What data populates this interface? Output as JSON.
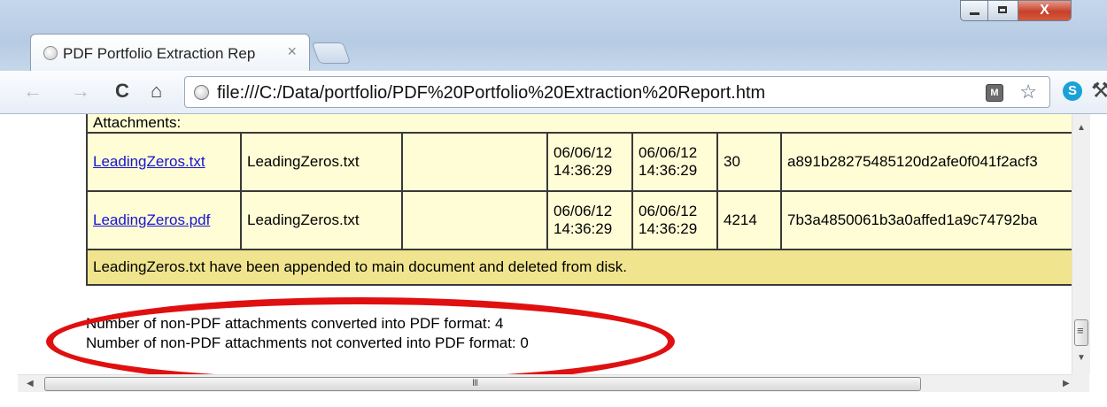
{
  "browser": {
    "tab_title": "PDF Portfolio Extraction Rep",
    "tab_close": "×",
    "address": "file:///C:/Data/portfolio/PDF%20Portfolio%20Extraction%20Report.htm",
    "nav": {
      "back": "←",
      "forward": "→",
      "reload": "C",
      "home": "⌂"
    },
    "window_controls": {
      "close": "X"
    },
    "star": "☆",
    "wrench": "🔧",
    "skype": "S",
    "shield": "M"
  },
  "report": {
    "section_header": "Attachments:",
    "rows": [
      {
        "link": "LeadingZeros.txt",
        "name": "LeadingZeros.txt",
        "description": "",
        "created_date": "06/06/12",
        "created_time": "14:36:29",
        "modified_date": "06/06/12",
        "modified_time": "14:36:29",
        "size": "30",
        "hash": "a891b28275485120d2afe0f041f2acf3"
      },
      {
        "link": "LeadingZeros.pdf",
        "name": "LeadingZeros.txt",
        "description": "",
        "created_date": "06/06/12",
        "created_time": "14:36:29",
        "modified_date": "06/06/12",
        "modified_time": "14:36:29",
        "size": "4214",
        "hash": "7b3a4850061b3a0affed1a9c74792ba"
      }
    ],
    "note": "LeadingZeros.txt have been appended to main document and deleted from disk."
  },
  "summary": {
    "converted": "Number of non-PDF attachments converted into PDF format: 4",
    "not_converted": "Number of non-PDF attachments not converted into PDF format: 0"
  },
  "colors": {
    "row_bg": "#fffdd6",
    "note_bg": "#f0e58e",
    "highlight_ellipse": "#e01010",
    "link": "#1515cf"
  }
}
